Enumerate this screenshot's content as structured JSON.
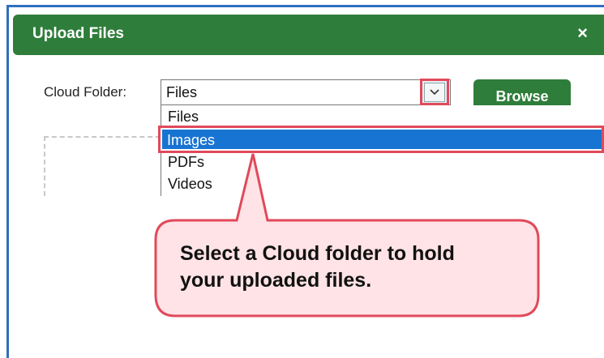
{
  "dialog": {
    "title": "Upload Files",
    "close_symbol": "×"
  },
  "form": {
    "cloud_folder_label": "Cloud Folder:",
    "selected_value": "Files",
    "browse_label": "Browse"
  },
  "dropdown": {
    "options": [
      "Files",
      "Images",
      "PDFs",
      "Videos"
    ],
    "highlighted": "Images"
  },
  "callout": {
    "line1": "Select a Cloud folder to hold",
    "line2": "your uploaded files."
  },
  "colors": {
    "header_green": "#2e7d3a",
    "highlight_blue": "#1874d2",
    "annotation_red": "#e04a5a",
    "frame_blue": "#2f6fbf"
  },
  "icons": {
    "close": "close-icon",
    "dropdown": "chevron-down-icon"
  }
}
